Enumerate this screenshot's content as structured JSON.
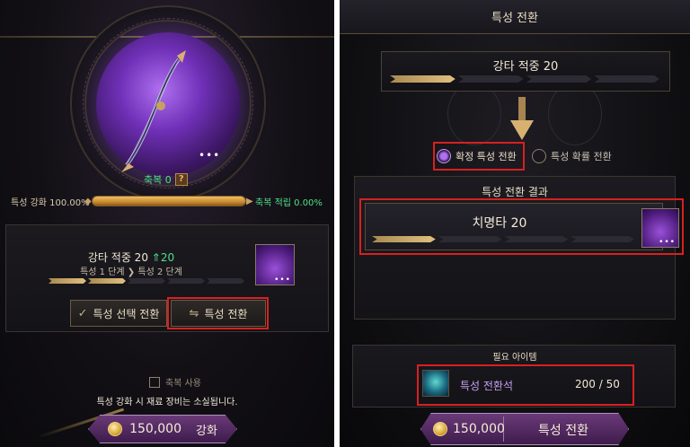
{
  "left": {
    "weapon": {
      "blessing_label": "축복 0",
      "help_icon_text": "?",
      "dots": "•••"
    },
    "gauge": {
      "left_label": "특성 강화 100.00%",
      "right_label": "축복 적립 0.00%",
      "fill_fraction": 1.0
    },
    "trait_card": {
      "name": "강타 적중  20",
      "increase": "⇑20",
      "stage_from": "특성 1 단계",
      "stage_to": "특성 2 단계",
      "stage_arrow": "❯",
      "stage_bar_total": 5,
      "stage_bar_filled": 2,
      "thumb_dots": "•••"
    },
    "buttons": {
      "select_convert": "특성 선택 전환",
      "convert": "특성 전환"
    },
    "use_blessing_label": "축복 사용",
    "warning": "특성 강화 시 재료 장비는 소실됩니다.",
    "enhance": {
      "cost": "150,000",
      "label": "강화"
    }
  },
  "right": {
    "header_title": "특성 전환",
    "source_trait": {
      "name": "강타 적중 20",
      "bar_total": 4,
      "bar_filled": 1
    },
    "modes": {
      "fixed": "확정 특성 전환",
      "probability": "특성 확률 전환",
      "selected": "fixed"
    },
    "result": {
      "title": "특성 전환 결과",
      "trait_name": "치명타 20",
      "bar_total": 4,
      "bar_filled": 1,
      "thumb_dots": "•••"
    },
    "required": {
      "title": "필요 아이템",
      "item_name": "특성 전환석",
      "count": "200  / 50"
    },
    "action": {
      "cost": "150,000",
      "label": "특성 전환"
    }
  },
  "colors": {
    "highlight": "#d82020",
    "accent_green": "#4ee08a",
    "gold": "#c88a30",
    "purple": "#7030b8"
  }
}
